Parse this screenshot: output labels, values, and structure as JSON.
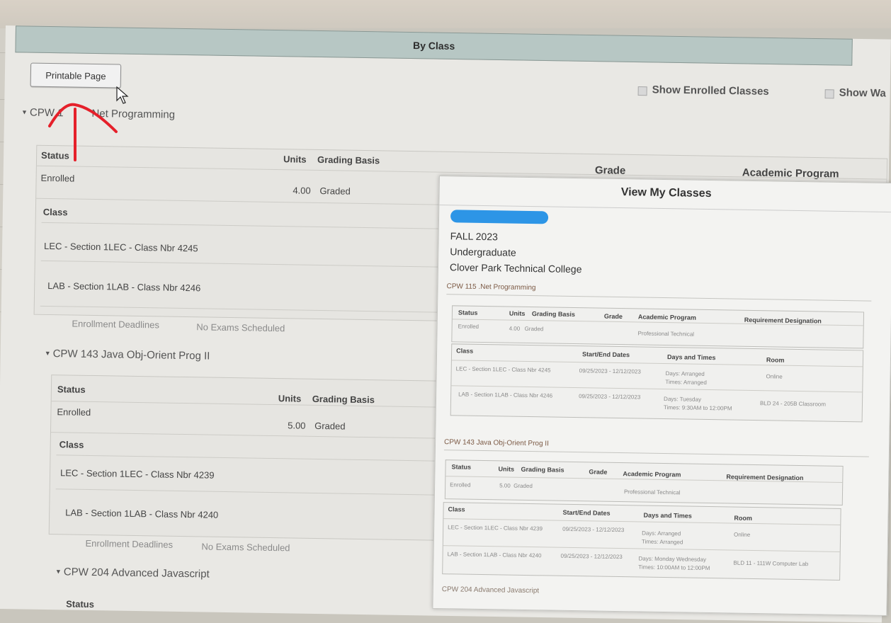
{
  "header": {
    "title": "By Class"
  },
  "toolbar": {
    "printable_label": "Printable Page",
    "show_enrolled_label": "Show Enrolled Classes",
    "show_waitlisted_label": "Show Wa"
  },
  "columns": {
    "status": "Status",
    "units": "Units",
    "grading_basis": "Grading Basis",
    "grade": "Grade",
    "academic_program": "Academic Program",
    "class": "Class"
  },
  "courses": [
    {
      "title_prefix": "CPW 1",
      "title_rest": "Net Programming",
      "status": "Enrolled",
      "units": "4.00",
      "grading": "Graded",
      "sections": [
        "LEC - Section 1LEC - Class Nbr 4245",
        "LAB - Section 1LAB - Class Nbr 4246"
      ],
      "deadlines": "Enrollment Deadlines",
      "exams": "No Exams Scheduled"
    },
    {
      "title": "CPW 143 Java Obj-Orient Prog II",
      "status": "Enrolled",
      "units": "5.00",
      "grading": "Graded",
      "sections": [
        "LEC - Section 1LEC - Class Nbr 4239",
        "LAB - Section 1LAB - Class Nbr 4240"
      ],
      "deadlines": "Enrollment Deadlines",
      "exams": "No Exams Scheduled"
    },
    {
      "title": "CPW 204 Advanced Javascript",
      "status": "Status"
    }
  ],
  "popup": {
    "title": "View My Classes",
    "term": "FALL 2023",
    "career": "Undergraduate",
    "institution": "Clover Park Technical College",
    "headers": {
      "status": "Status",
      "units": "Units",
      "grading": "Grading Basis",
      "grade": "Grade",
      "program": "Academic Program",
      "req": "Requirement Designation",
      "class": "Class",
      "dates": "Start/End Dates",
      "days": "Days and Times",
      "room": "Room"
    },
    "courses": [
      {
        "title": "CPW 115 .Net Programming",
        "status": "Enrolled",
        "units": "4.00",
        "grading": "Graded",
        "program": "Professional Technical",
        "rows": [
          {
            "class": "LEC - Section 1LEC - Class Nbr 4245",
            "dates": "09/25/2023 - 12/12/2023",
            "days": "Days: Arranged",
            "times": "Times: Arranged",
            "room": "Online"
          },
          {
            "class": "LAB - Section 1LAB - Class Nbr 4246",
            "dates": "09/25/2023 - 12/12/2023",
            "days": "Days: Tuesday",
            "times": "Times: 9:30AM to 12:00PM",
            "room": "BLD 24 - 205B Classroom"
          }
        ]
      },
      {
        "title": "CPW 143 Java Obj-Orient Prog II",
        "status": "Enrolled",
        "units": "5.00",
        "grading": "Graded",
        "program": "Professional Technical",
        "rows": [
          {
            "class": "LEC - Section 1LEC - Class Nbr 4239",
            "dates": "09/25/2023 - 12/12/2023",
            "days": "Days: Arranged",
            "times": "Times: Arranged",
            "room": "Online"
          },
          {
            "class": "LAB - Section 1LAB - Class Nbr 4240",
            "dates": "09/25/2023 - 12/12/2023",
            "days": "Days: Monday Wednesday",
            "times": "Times: 10:00AM to 12:00PM",
            "room": "BLD 11 - 111W Computer Lab"
          }
        ]
      },
      {
        "title": "CPW 204 Advanced Javascript"
      }
    ]
  },
  "colors": {
    "header_bg": "#b7c7c4",
    "annotation": "#e5202a",
    "redaction": "#2d95e6"
  }
}
